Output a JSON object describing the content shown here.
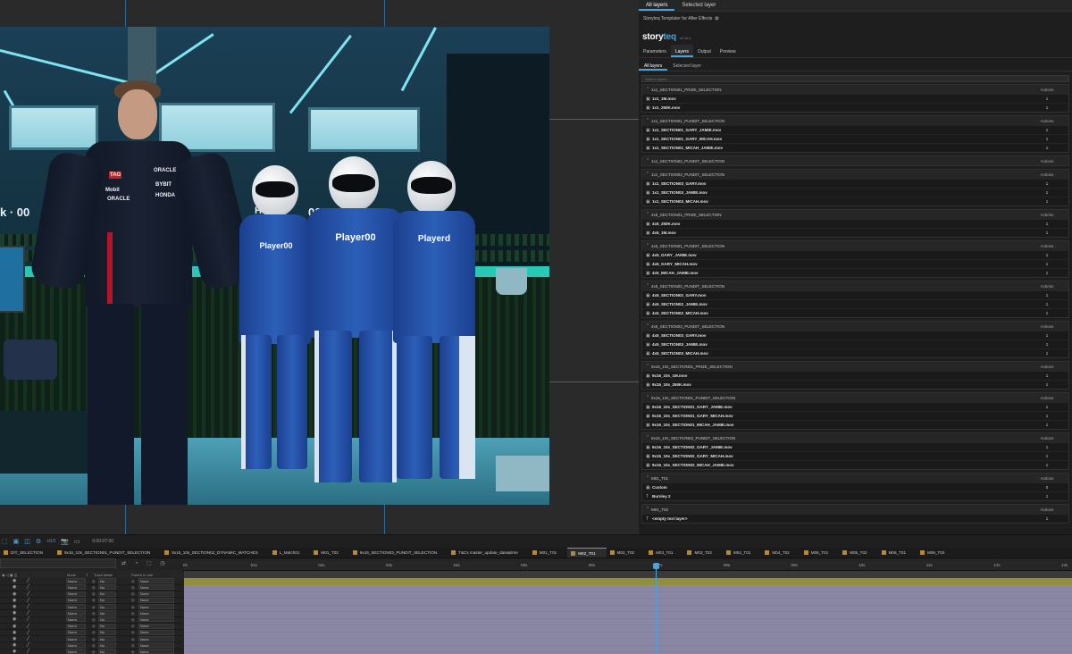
{
  "panel": {
    "top_tabs": [
      "All layers",
      "Selected layer"
    ],
    "plugin_title": "Storyteq Templater for After Effects",
    "close_glyph": "⊠",
    "logo_story": "story",
    "logo_teq": "teq",
    "version": "v2.16.1",
    "main_tabs": [
      "Parameters",
      "Layers",
      "Output",
      "Preview"
    ],
    "active_main_tab": "Layers",
    "sub_tabs": [
      "All layers",
      "Selected layer"
    ],
    "search_placeholder": "Search layers...",
    "actions_label": "Actions",
    "groups": [
      {
        "name": "1x1_SECTION01_PRIZE_SELECTION",
        "rows": [
          {
            "icon": "file-video-icon",
            "name": "1x1_1M.mov",
            "value": "1"
          },
          {
            "icon": "file-video-icon",
            "name": "1x1_250K.mov",
            "value": "1"
          }
        ]
      },
      {
        "name": "1x1_SECTION01_PUNDIT_SELECTION",
        "rows": [
          {
            "icon": "file-video-icon",
            "name": "1x1_SECTION01_GARY_JAMIE.mov",
            "value": "1"
          },
          {
            "icon": "file-video-icon",
            "name": "1x1_SECTION01_GARY_MICAH.mov",
            "value": "1"
          },
          {
            "icon": "file-video-icon",
            "name": "1x1_SECTION01_MICAH_JAMIE.mov",
            "value": "1"
          }
        ]
      },
      {
        "name": "1x1_SECTION02_PUNDIT_SELECTION",
        "rows": []
      },
      {
        "name": "1x1_SECTION03_PUNDIT_SELECTION",
        "rows": [
          {
            "icon": "file-video-icon",
            "name": "1x1_SECTION03_GARY.mov",
            "value": "1"
          },
          {
            "icon": "file-video-icon",
            "name": "1x1_SECTION03_JAMIE.mov",
            "value": "1"
          },
          {
            "icon": "file-video-icon",
            "name": "1x1_SECTION03_MICAH.mov",
            "value": "1"
          }
        ]
      },
      {
        "name": "4x5_SECTION01_PRIZE_SELECTION",
        "rows": [
          {
            "icon": "file-video-icon",
            "name": "4x5_250K.mov",
            "value": "1"
          },
          {
            "icon": "file-video-icon",
            "name": "4x5_1M.mov",
            "value": "1"
          }
        ]
      },
      {
        "name": "4x5_SECTION01_PUNDIT_SELECTION",
        "rows": [
          {
            "icon": "file-video-icon",
            "name": "4x5_GARY_JAMIE.mov",
            "value": "1"
          },
          {
            "icon": "file-video-icon",
            "name": "4x5_GARY_MICAH.mov",
            "value": "1"
          },
          {
            "icon": "file-video-icon",
            "name": "4x5_MICAH_JAMIE.mov",
            "value": "1"
          }
        ]
      },
      {
        "name": "4x5_SECTION02_PUNDIT_SELECTION",
        "rows": [
          {
            "icon": "file-video-icon",
            "name": "4x5_SECTION02_GARY.mov",
            "value": "1"
          },
          {
            "icon": "file-video-icon",
            "name": "4x5_SECTION02_JAMIE.mov",
            "value": "1"
          },
          {
            "icon": "file-video-icon",
            "name": "4x5_SECTION02_MICAH.mov",
            "value": "1"
          }
        ]
      },
      {
        "name": "4x5_SECTION03_PUNDIT_SELECTION",
        "rows": [
          {
            "icon": "file-video-icon",
            "name": "4x5_SECTION03_GARY.mov",
            "value": "1"
          },
          {
            "icon": "file-video-icon",
            "name": "4x5_SECTION03_JAMIE.mov",
            "value": "1"
          },
          {
            "icon": "file-video-icon",
            "name": "4x5_SECTION03_MICAH.mov",
            "value": "1"
          }
        ]
      },
      {
        "name": "9x16_10s_SECTION01_PRIZE_SELECTION",
        "rows": [
          {
            "icon": "file-video-icon",
            "name": "9x16_10s_1M.mov",
            "value": "1"
          },
          {
            "icon": "file-video-icon",
            "name": "9x16_10s_250K.mov",
            "value": "1"
          }
        ]
      },
      {
        "name": "9x16_10s_SECTION01_PUNDIT_SELECTION",
        "rows": [
          {
            "icon": "file-video-icon",
            "name": "9x16_10s_SECTION01_GARY_JAMIE.mov",
            "value": "1"
          },
          {
            "icon": "file-video-icon",
            "name": "9x16_10s_SECTION01_GARY_MICAH.mov",
            "value": "1"
          },
          {
            "icon": "file-video-icon",
            "name": "9x16_10s_SECTION01_MICAH_JAMIE.mov",
            "value": "1"
          }
        ]
      },
      {
        "name": "9x16_10s_SECTION02_PUNDIT_SELECTION",
        "rows": [
          {
            "icon": "file-video-icon",
            "name": "9x16_10s_SECTION02_GARY_JAMIE.mov",
            "value": "1"
          },
          {
            "icon": "file-video-icon",
            "name": "9x16_10s_SECTION02_GARY_MICAH.mov",
            "value": "1"
          },
          {
            "icon": "file-video-icon",
            "name": "9x16_10s_SECTION02_MICAH_JAMIE.mov",
            "value": "1"
          }
        ]
      },
      {
        "name": "M01_T01",
        "rows": [
          {
            "icon": "file-video-icon",
            "name": "Custom",
            "value": "0"
          },
          {
            "icon": "text-layer-icon",
            "name": "Burnley 2",
            "value": "1"
          }
        ]
      },
      {
        "name": "M01_T02",
        "rows": [
          {
            "icon": "text-layer-icon",
            "name": "<empty text layer>",
            "value": "1"
          }
        ]
      }
    ]
  },
  "scene": {
    "player_text": "Player00",
    "player_text_alt": "Playerd",
    "score_text": "00",
    "score_left": "k · 00",
    "he_text": "He",
    "sponsors": [
      "TAG",
      "ORACLE",
      "Mobil",
      "BYBIT",
      "ORACLE",
      "HONDA"
    ]
  },
  "timeline": {
    "timecode": "0:00:07:00",
    "zoom_label": "+0.0",
    "comp_tabs": [
      {
        "label": "DIT_SELECTION",
        "active": false
      },
      {
        "label": "9x16_10s_SECTION01_PUNDIT_SELECTION",
        "active": false
      },
      {
        "label": "9x16_10s_SECTION02_DYNAMIC_MATCHES",
        "active": false
      },
      {
        "label": "L_Match01",
        "active": false
      },
      {
        "label": "M01_T02",
        "active": false
      },
      {
        "label": "9x16_SECTION03_PUNDIT_SELECTION",
        "active": false
      },
      {
        "label": "T&Cs master_update_date&time",
        "active": false
      },
      {
        "label": "M01_T01",
        "active": false
      },
      {
        "label": "M02_T01",
        "active": true
      },
      {
        "label": "M02_T02",
        "active": false
      },
      {
        "label": "M03_T01",
        "active": false
      },
      {
        "label": "M03_T02",
        "active": false
      },
      {
        "label": "M04_T01",
        "active": false
      },
      {
        "label": "M04_T02",
        "active": false
      },
      {
        "label": "M05_T01",
        "active": false
      },
      {
        "label": "M05_T02",
        "active": false
      },
      {
        "label": "M06_T01",
        "active": false
      },
      {
        "label": "M06_T02",
        "active": false
      }
    ],
    "ruler_ticks": [
      "0s",
      "01s",
      "02s",
      "03s",
      "04s",
      "05s",
      "06s",
      "07s",
      "08s",
      "09s",
      "10s",
      "11s",
      "12s",
      "13s"
    ],
    "header": {
      "mode": "Mode",
      "t": "T",
      "trkmat": "Track Matte",
      "parent": "Parent & Link"
    },
    "layer_rows": [
      {
        "mode": "Norm",
        "mat": "No",
        "parent": "None"
      },
      {
        "mode": "Norm",
        "mat": "No",
        "parent": "None"
      },
      {
        "mode": "Norm",
        "mat": "No",
        "parent": "None"
      },
      {
        "mode": "Norm",
        "mat": "No",
        "parent": "None"
      },
      {
        "mode": "Norm",
        "mat": "No",
        "parent": "None"
      },
      {
        "mode": "Norm",
        "mat": "No",
        "parent": "None"
      },
      {
        "mode": "Norm",
        "mat": "No",
        "parent": "None"
      },
      {
        "mode": "Norm",
        "mat": "No",
        "parent": "None"
      },
      {
        "mode": "Norm",
        "mat": "No",
        "parent": "None"
      },
      {
        "mode": "Norm",
        "mat": "No",
        "parent": "None"
      },
      {
        "mode": "Norm",
        "mat": "No",
        "parent": "None"
      },
      {
        "mode": "Norm",
        "mat": "No",
        "parent": "None"
      }
    ],
    "playhead_seconds": 7,
    "duration_seconds": 13,
    "colors": {
      "accent": "#4aa3df",
      "olive": "#8f8f3c",
      "lavender": "#8a87a4"
    }
  }
}
